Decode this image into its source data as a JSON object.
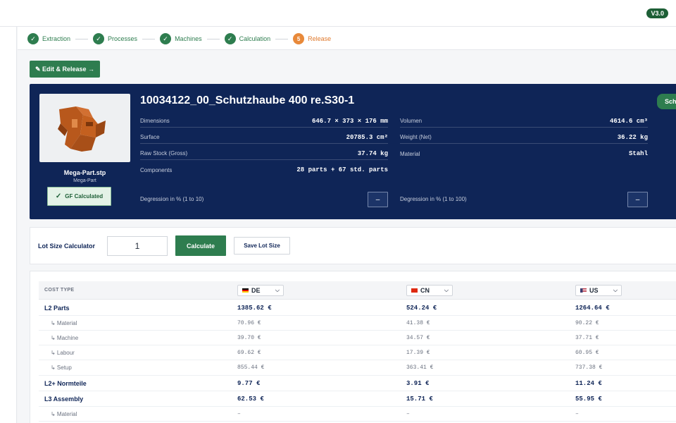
{
  "header": {
    "version": "V3.0"
  },
  "stepper": [
    {
      "label": "Extraction",
      "mark": "✓",
      "state": "done"
    },
    {
      "label": "Processes",
      "mark": "✓",
      "state": "done"
    },
    {
      "label": "Machines",
      "mark": "✓",
      "state": "done"
    },
    {
      "label": "Calculation",
      "mark": "✓",
      "state": "done"
    },
    {
      "label": "Release",
      "mark": "5",
      "state": "active"
    }
  ],
  "actions": {
    "edit_release": "✎ Edit & Release →"
  },
  "product": {
    "file_name": "Mega-Part.stp",
    "file_sub": "Mega-Part",
    "gf_badge": "GF Calculated",
    "gf_check": "✓",
    "title": "10034122_00_Schutzhaube 400 re.S30-1",
    "side_button": "Sch",
    "props_left": [
      {
        "label": "Dimensions",
        "value": "646.7 × 373 × 176 mm"
      },
      {
        "label": "Surface",
        "value": "20785.3 cm²"
      },
      {
        "label": "Raw Stock (Gross)",
        "value": "37.74 kg"
      },
      {
        "label": "Components",
        "value": "28 parts + 67 std. parts"
      }
    ],
    "props_right": [
      {
        "label": "Volumen",
        "value": "4614.6 cm³"
      },
      {
        "label": "Weight (Net)",
        "value": "36.22 kg"
      },
      {
        "label": "Material",
        "value": "Stahl"
      }
    ],
    "degression_left": {
      "label": "Degression in % (1 to 10)",
      "button": "–"
    },
    "degression_right": {
      "label": "Degression in % (1 to 100)",
      "button": "–"
    }
  },
  "lot": {
    "label": "Lot Size Calculator",
    "value": "1",
    "calculate": "Calculate",
    "save": "Save Lot Size"
  },
  "costs": {
    "header": {
      "cost_type": "COST TYPE",
      "countries": [
        {
          "code": "DE",
          "flag_colors": [
            "#000000",
            "#dd0000",
            "#ffce00"
          ]
        },
        {
          "code": "CN",
          "flag_colors": [
            "#de2910",
            "#de2910",
            "#de2910"
          ]
        },
        {
          "code": "US",
          "flag_colors": [
            "#b22234",
            "#ffffff",
            "#3c3b6e"
          ]
        }
      ],
      "chevron": "⌵"
    },
    "rows": [
      {
        "label": "L2 Parts",
        "level": "main",
        "values": [
          "1385.62 €",
          "524.24 €",
          "1264.64 €"
        ]
      },
      {
        "label": "↳ Material",
        "level": "sub",
        "values": [
          "70.96 €",
          "41.38 €",
          "90.22 €"
        ]
      },
      {
        "label": "↳ Machine",
        "level": "sub",
        "values": [
          "39.70 €",
          "34.57 €",
          "37.71 €"
        ]
      },
      {
        "label": "↳ Labour",
        "level": "sub",
        "values": [
          "69.62 €",
          "17.39 €",
          "60.95 €"
        ]
      },
      {
        "label": "↳ Setup",
        "level": "sub",
        "values": [
          "855.44 €",
          "363.41 €",
          "737.38 €"
        ]
      },
      {
        "label": "L2+ Normteile",
        "level": "main",
        "values": [
          "9.77 €",
          "3.91 €",
          "11.24 €"
        ]
      },
      {
        "label": "L3 Assembly",
        "level": "main",
        "values": [
          "62.53 €",
          "15.71 €",
          "55.95 €"
        ]
      },
      {
        "label": "↳ Material",
        "level": "sub",
        "values": [
          "–",
          "–",
          "–"
        ]
      }
    ]
  }
}
